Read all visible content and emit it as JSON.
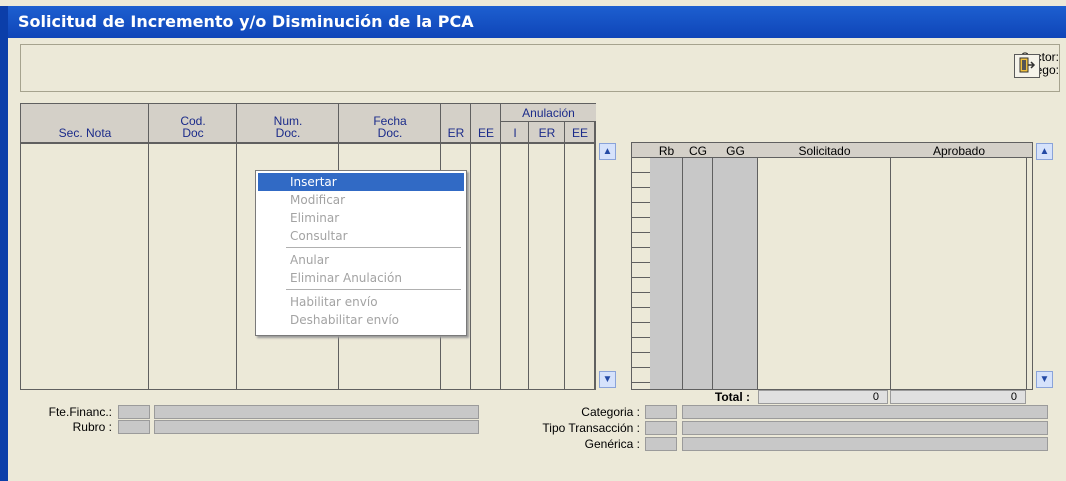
{
  "window": {
    "title": "Solicitud de Incremento y/o Disminución de la PCA"
  },
  "header": {
    "sector_label": "Sector:",
    "pliego_label": "Pliego:"
  },
  "grid": {
    "group_header": "Anulación",
    "columns": [
      "Sec. Nota",
      "Cod.",
      "Doc",
      "Num.",
      "Doc.",
      "Fecha",
      "Doc.",
      "ER",
      "EE",
      "I",
      "ER",
      "EE"
    ]
  },
  "right_grid": {
    "columns": [
      "Rb",
      "CG",
      "GG",
      "Solicitado",
      "Aprobado"
    ],
    "total_label": "Total :",
    "total_solicitado": "0",
    "total_aprobado": "0"
  },
  "context_menu": {
    "items": [
      "Insertar",
      "Modificar",
      "Eliminar",
      "Consultar",
      "Anular",
      "Eliminar Anulación",
      "Habilitar envío",
      "Deshabilitar envío"
    ]
  },
  "footer": {
    "fte_label": "Fte.Financ.:",
    "rubro_label": "Rubro :",
    "categoria_label": "Categoria :",
    "tipo_label": "Tipo Transacción :",
    "generica_label": "Genérica :"
  }
}
